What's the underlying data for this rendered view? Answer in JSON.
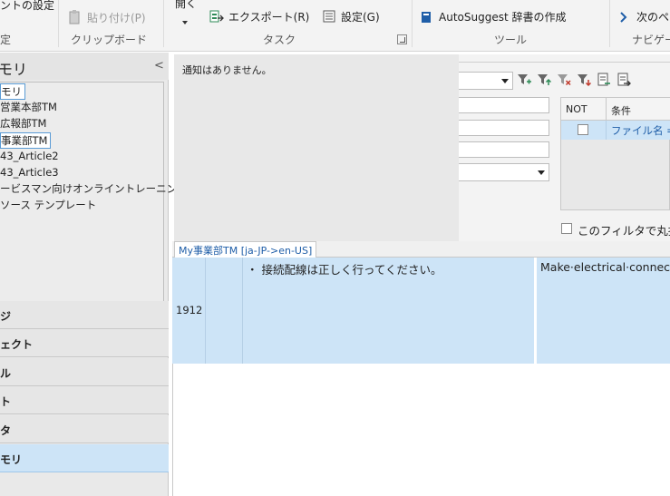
{
  "ribbon": {
    "partial_top_left": "ントの設定",
    "paste": "貼り付け(P)",
    "open": "開く",
    "export": "エクスポート(R)",
    "settings": "設定(G)",
    "autosuggest": "AutoSuggest 辞書の作成",
    "next_page": "次のペ",
    "groups": {
      "settings_group": "定",
      "clipboard": "クリップボード",
      "tasks": "タスク",
      "tools": "ツール",
      "navigation": "ナビゲー"
    }
  },
  "left_panel": {
    "title": "モリ",
    "collapse_glyph": "<",
    "tree_items": [
      "モリ",
      "営業本部TM",
      "広報部TM",
      "事業部TM",
      "43_Article2",
      "43_Article3",
      "ービスマン向けオンライントレーニング",
      "ソース テンプレート"
    ],
    "nav_buttons": [
      "ジ",
      "ェクト",
      "ル",
      "ト",
      "タ",
      "モリ"
    ]
  },
  "notification": {
    "text": "通知はありません。"
  },
  "filter": {
    "grid_headers": [
      "NOT",
      "条件"
    ],
    "grid_row_condition": "ファイル名 =",
    "round_label": "このフィルタで丸扱"
  },
  "editor": {
    "tab_label": "My事業部TM [ja-JP->en-US]",
    "segment_number": "1912",
    "source_text": "・ 接続配線は正しく行ってください。",
    "target_text": "Make·electrical·connectio"
  },
  "colors": {
    "selection_blue": "#cde4f7",
    "link_blue": "#1f5ea8",
    "autosuggest_icon": "#1f5ea8",
    "export_icon": "#2e8b57"
  }
}
